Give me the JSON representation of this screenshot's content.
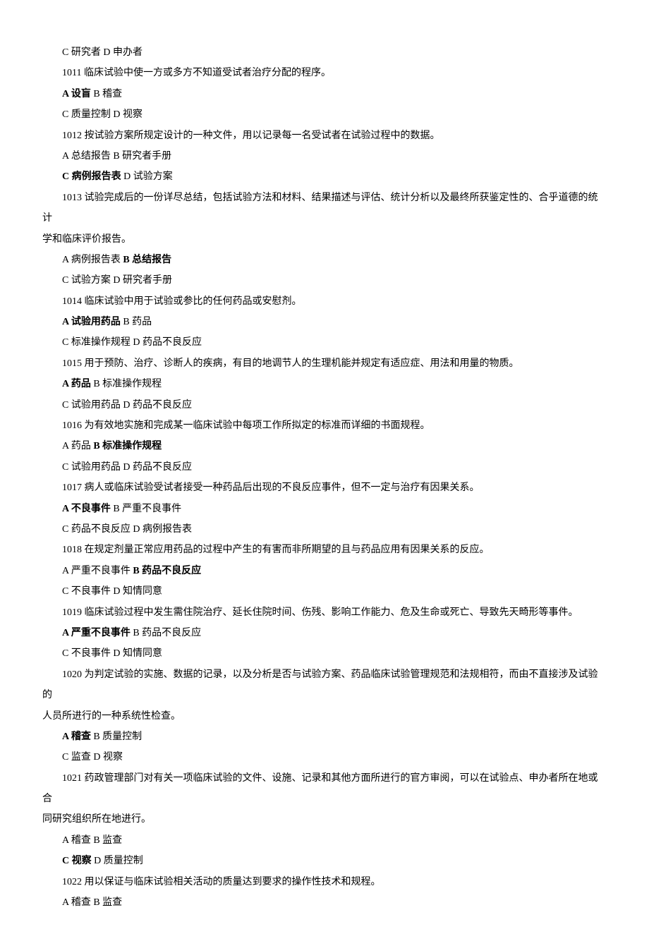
{
  "lines": [
    {
      "segments": [
        {
          "text": "C 研究者 D 申办者",
          "bold": false
        }
      ]
    },
    {
      "segments": [
        {
          "text": "1011 临床试验中使一方或多方不知道受试者治疗分配的程序。",
          "bold": false
        }
      ]
    },
    {
      "segments": [
        {
          "text": "A 设盲",
          "bold": true
        },
        {
          "text": " B 稽查",
          "bold": false
        }
      ]
    },
    {
      "segments": [
        {
          "text": "C 质量控制 D 视察",
          "bold": false
        }
      ]
    },
    {
      "segments": [
        {
          "text": "1012 按试验方案所规定设计的一种文件，用以记录每一名受试者在试验过程中的数据。",
          "bold": false
        }
      ]
    },
    {
      "segments": [
        {
          "text": "A 总结报告 B 研究者手册",
          "bold": false
        }
      ]
    },
    {
      "segments": [
        {
          "text": "C 病例报告表",
          "bold": true
        },
        {
          "text": " D 试验方案",
          "bold": false
        }
      ]
    },
    {
      "segments": [
        {
          "text": "1013 试验完成后的一份详尽总结，包括试验方法和材料、结果描述与评估、统计分析以及最终所获鉴定性的、合乎道德的统计",
          "bold": false
        }
      ]
    },
    {
      "segments": [
        {
          "text": "学和临床评价报告。",
          "bold": false
        }
      ],
      "noindent": true
    },
    {
      "segments": [
        {
          "text": "A 病例报告表 ",
          "bold": false
        },
        {
          "text": "B 总结报告",
          "bold": true
        }
      ]
    },
    {
      "segments": [
        {
          "text": "C 试验方案 D 研究者手册",
          "bold": false
        }
      ]
    },
    {
      "segments": [
        {
          "text": "1014 临床试验中用于试验或参比的任何药品或安慰剂。",
          "bold": false
        }
      ]
    },
    {
      "segments": [
        {
          "text": "A 试验用药品",
          "bold": true
        },
        {
          "text": " B 药品",
          "bold": false
        }
      ]
    },
    {
      "segments": [
        {
          "text": "C 标准操作规程 D 药品不良反应",
          "bold": false
        }
      ]
    },
    {
      "segments": [
        {
          "text": "1015 用于预防、治疗、诊断人的疾病，有目的地调节人的生理机能并规定有适应症、用法和用量的物质。",
          "bold": false
        }
      ]
    },
    {
      "segments": [
        {
          "text": "A 药品",
          "bold": true
        },
        {
          "text": " B 标准操作规程",
          "bold": false
        }
      ]
    },
    {
      "segments": [
        {
          "text": "C 试验用药品 D 药品不良反应",
          "bold": false
        }
      ]
    },
    {
      "segments": [
        {
          "text": "1016 为有效地实施和完成某一临床试验中每项工作所拟定的标准而详细的书面规程。",
          "bold": false
        }
      ]
    },
    {
      "segments": [
        {
          "text": "A 药品 ",
          "bold": false
        },
        {
          "text": "B 标准操作规程",
          "bold": true
        }
      ]
    },
    {
      "segments": [
        {
          "text": "C 试验用药品 D 药品不良反应",
          "bold": false
        }
      ]
    },
    {
      "segments": [
        {
          "text": "1017 病人或临床试验受试者接受一种药品后出现的不良反应事件，但不一定与治疗有因果关系。",
          "bold": false
        }
      ]
    },
    {
      "segments": [
        {
          "text": "A 不良事件",
          "bold": true
        },
        {
          "text": " B 严重不良事件",
          "bold": false
        }
      ]
    },
    {
      "segments": [
        {
          "text": "C 药品不良反应 D 病例报告表",
          "bold": false
        }
      ]
    },
    {
      "segments": [
        {
          "text": "1018 在规定剂量正常应用药品的过程中产生的有害而非所期望的且与药品应用有因果关系的反应。",
          "bold": false
        }
      ]
    },
    {
      "segments": [
        {
          "text": "A 严重不良事件 ",
          "bold": false
        },
        {
          "text": "B 药品不良反应",
          "bold": true
        }
      ]
    },
    {
      "segments": [
        {
          "text": "C 不良事件 D 知情同意",
          "bold": false
        }
      ]
    },
    {
      "segments": [
        {
          "text": "1019 临床试验过程中发生需住院治疗、延长住院时间、伤残、影响工作能力、危及生命或死亡、导致先天畸形等事件。",
          "bold": false
        }
      ]
    },
    {
      "segments": [
        {
          "text": "A 严重不良事件",
          "bold": true
        },
        {
          "text": " B 药品不良反应",
          "bold": false
        }
      ]
    },
    {
      "segments": [
        {
          "text": "C 不良事件 D 知情同意",
          "bold": false
        }
      ]
    },
    {
      "segments": [
        {
          "text": "1020 为判定试验的实施、数据的记录，以及分析是否与试验方案、药品临床试验管理规范和法规相符，而由不直接涉及试验的",
          "bold": false
        }
      ]
    },
    {
      "segments": [
        {
          "text": "人员所进行的一种系统性检查。",
          "bold": false
        }
      ],
      "noindent": true
    },
    {
      "segments": [
        {
          "text": "A 稽查",
          "bold": true
        },
        {
          "text": " B 质量控制",
          "bold": false
        }
      ]
    },
    {
      "segments": [
        {
          "text": "C 监查 D 视察",
          "bold": false
        }
      ]
    },
    {
      "segments": [
        {
          "text": "1021 药政管理部门对有关一项临床试验的文件、设施、记录和其他方面所进行的官方审阅，可以在试验点、申办者所在地或合",
          "bold": false
        }
      ]
    },
    {
      "segments": [
        {
          "text": "同研究组织所在地进行。",
          "bold": false
        }
      ],
      "noindent": true
    },
    {
      "segments": [
        {
          "text": "A 稽查 B 监查",
          "bold": false
        }
      ]
    },
    {
      "segments": [
        {
          "text": "C 视察",
          "bold": true
        },
        {
          "text": " D 质量控制",
          "bold": false
        }
      ]
    },
    {
      "segments": [
        {
          "text": "1022 用以保证与临床试验相关活动的质量达到要求的操作性技术和规程。",
          "bold": false
        }
      ]
    },
    {
      "segments": [
        {
          "text": "A 稽查 B 监查",
          "bold": false
        }
      ]
    }
  ]
}
